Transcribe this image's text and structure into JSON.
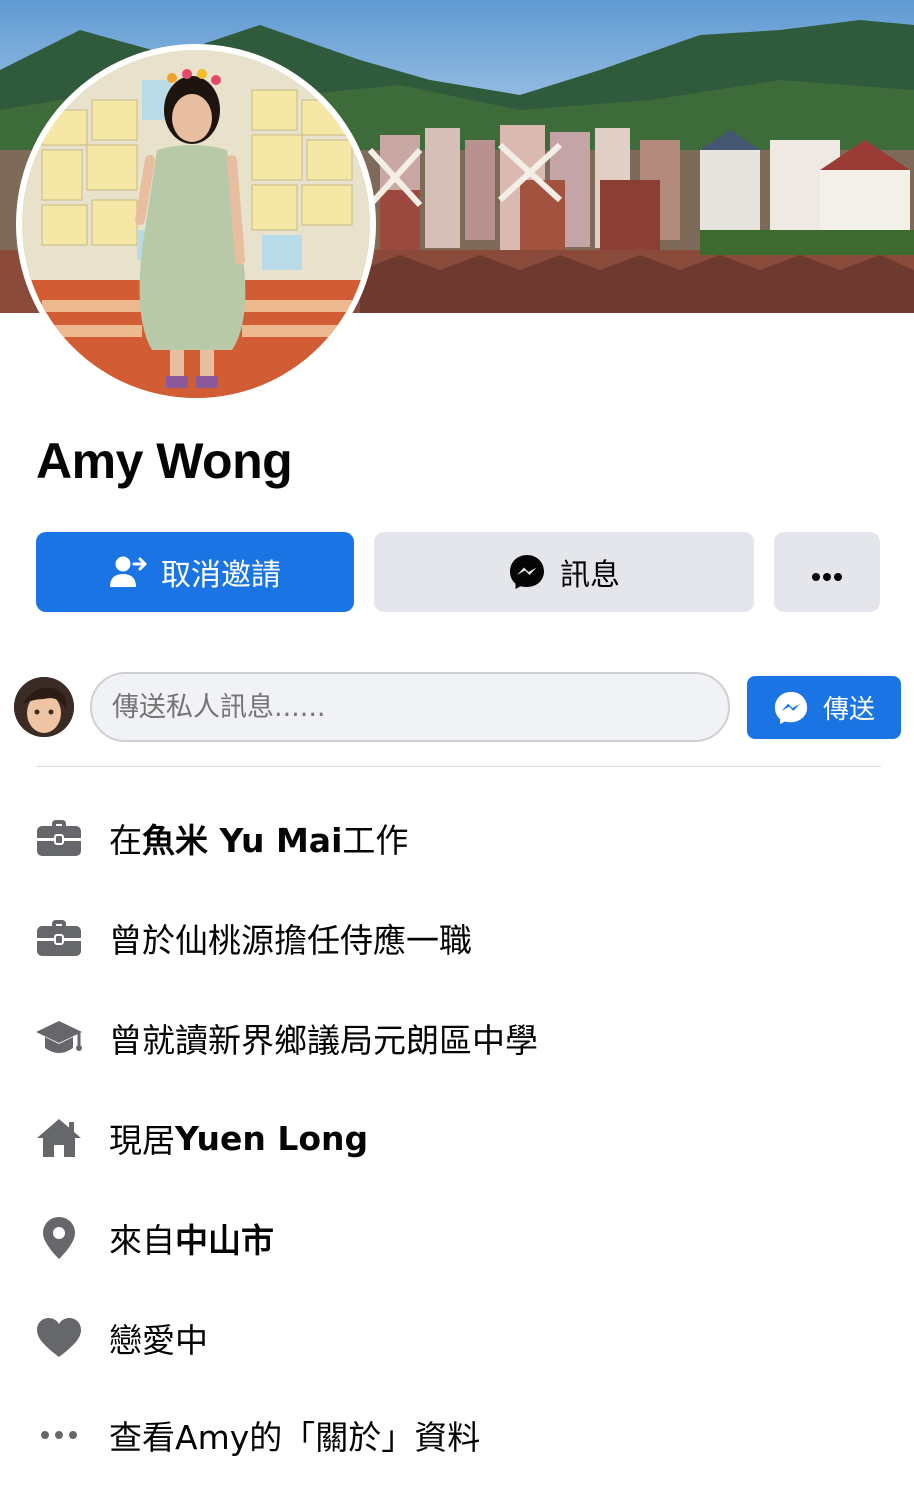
{
  "profile": {
    "name": "Amy Wong"
  },
  "actions": {
    "cancel_request_label": "取消邀請",
    "message_label": "訊息",
    "more_label": "•••"
  },
  "composer": {
    "placeholder": "傳送私人訊息......",
    "send_label": "傳送"
  },
  "intro": {
    "work": {
      "prefix": "在",
      "bold": "魚米 Yu Mai",
      "suffix": " 工作",
      "icon": "briefcase-icon"
    },
    "past_work": {
      "text": "曾於仙桃源擔任侍應一職",
      "icon": "briefcase-icon"
    },
    "education": {
      "text": "曾就讀新界鄉議局元朗區中學",
      "icon": "graduation-cap-icon"
    },
    "lives": {
      "prefix": "現居 ",
      "bold": "Yuen Long",
      "icon": "home-icon"
    },
    "from": {
      "prefix": "來自",
      "bold": "中山市",
      "icon": "location-pin-icon"
    },
    "relationship": {
      "text": "戀愛中",
      "icon": "heart-icon"
    },
    "see_about": {
      "text": "查看Amy的「關於」資料",
      "icon": "more-dots-icon"
    }
  },
  "colors": {
    "primary": "#1b74e4",
    "secondary_bg": "#e4e6eb",
    "icon_gray": "#65676b",
    "text": "#050505"
  }
}
